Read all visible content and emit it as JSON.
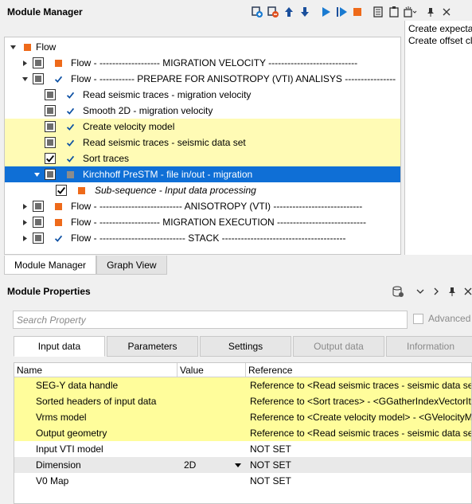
{
  "module_manager": {
    "title": "Module Manager",
    "tree": [
      {
        "label": "Flow",
        "status": "orange",
        "expander": "expanded",
        "checkbox": "none",
        "level": 0,
        "style": "normal"
      },
      {
        "label": "Flow - -------------------  MIGRATION  VELOCITY  ----------------------------",
        "status": "orange",
        "expander": "collapsed",
        "checkbox": "partial",
        "level": 1,
        "style": "normal"
      },
      {
        "label": "Flow - ----------- PREPARE FOR ANISOTROPY (VTI) ANALISYS ----------------",
        "status": "check",
        "expander": "expanded",
        "checkbox": "partial",
        "level": 1,
        "style": "normal"
      },
      {
        "label": "Read seismic traces - migration velocity",
        "status": "check",
        "expander": "none",
        "checkbox": "partial",
        "level": 2,
        "style": "normal"
      },
      {
        "label": "Smooth 2D - migration velocity",
        "status": "check",
        "expander": "none",
        "checkbox": "partial",
        "level": 2,
        "style": "normal"
      },
      {
        "label": "Create velocity model",
        "status": "check",
        "expander": "none",
        "checkbox": "partial",
        "level": 2,
        "style": "hl"
      },
      {
        "label": "Read seismic traces - seismic data set",
        "status": "check",
        "expander": "none",
        "checkbox": "partial",
        "level": 2,
        "style": "hl"
      },
      {
        "label": "Sort traces",
        "status": "check",
        "expander": "none",
        "checkbox": "checked",
        "level": 2,
        "style": "hl"
      },
      {
        "label": "Kirchhoff PreSTM - file in/out - migration",
        "status": "gray",
        "expander": "expanded",
        "checkbox": "partial",
        "level": 2,
        "style": "sel"
      },
      {
        "label": "Sub-sequence - Input data processing",
        "status": "orange",
        "expander": "none",
        "checkbox": "checked",
        "level": 3,
        "style": "italic"
      },
      {
        "label": "Flow - -------------------------- ANISOTROPY (VTI) ----------------------------",
        "status": "orange",
        "expander": "collapsed",
        "checkbox": "partial",
        "level": 1,
        "style": "normal"
      },
      {
        "label": "Flow - -------------------  MIGRATION  EXECUTION  ----------------------------",
        "status": "orange",
        "expander": "collapsed",
        "checkbox": "partial",
        "level": 1,
        "style": "normal"
      },
      {
        "label": "Flow - --------------------------- STACK ---------------------------------------",
        "status": "check",
        "expander": "collapsed",
        "checkbox": "partial",
        "level": 1,
        "style": "normal"
      }
    ],
    "description_lines": [
      "Create expectable",
      "Create offset cla"
    ],
    "tabs": [
      "Module Manager",
      "Graph View"
    ],
    "active_tab": "Module Manager"
  },
  "module_properties": {
    "title": "Module Properties",
    "search_placeholder": "Search Property",
    "advanced_label": "Advanced",
    "tabs": [
      "Input data",
      "Parameters",
      "Settings",
      "Output data",
      "Information"
    ],
    "active_tab": "Input data",
    "columns": [
      "Name",
      "Value",
      "Reference"
    ],
    "rows": [
      {
        "name": "SEG-Y data handle",
        "value": "",
        "reference": "Reference to <Read seismic traces - seismic data set> - <SEGYDataHandle>",
        "style": "hl"
      },
      {
        "name": "Sorted headers of input data",
        "value": "",
        "reference": "Reference to <Sort traces> - <GGatherIndexVectorItem>",
        "style": "hl"
      },
      {
        "name": "Vrms model",
        "value": "",
        "reference": "Reference to <Create velocity model> - <GVelocityModel>",
        "style": "hl"
      },
      {
        "name": "Output geometry",
        "value": "",
        "reference": "Reference to <Read seismic traces - seismic data set> - <Geometry>",
        "style": "hl"
      },
      {
        "name": "Input VTI model",
        "value": "",
        "reference": "NOT SET",
        "style": "normal"
      },
      {
        "name": "Dimension",
        "value": "2D",
        "reference": "NOT SET",
        "style": "alt"
      },
      {
        "name": "V0 Map",
        "value": "",
        "reference": "NOT SET",
        "style": "normal"
      }
    ]
  },
  "colors": {
    "selection": "#0f6fd6",
    "highlight": "#fffbb5",
    "orange_status": "#ee6a1a",
    "check_blue": "#0b4fa3"
  }
}
